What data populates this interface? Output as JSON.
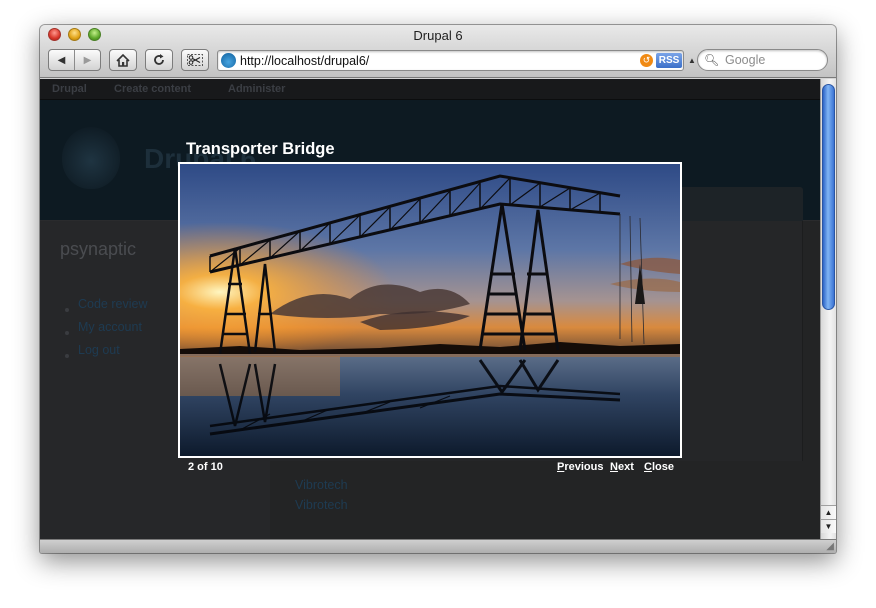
{
  "window": {
    "title": "Drupal 6"
  },
  "toolbar": {
    "back_label": "◀",
    "forward_label": "▶",
    "home_icon": "home-icon",
    "reload_icon": "reload-icon",
    "snippet_icon": "scissors-icon"
  },
  "address": {
    "url": "http://localhost/drupal6/",
    "rss_label": "RSS",
    "snapback_label": "↺"
  },
  "search": {
    "placeholder": "Google"
  },
  "page": {
    "menu": [
      "Drupal",
      "Create content",
      "Administer"
    ],
    "site_name": "Drupal 6",
    "user_name": "psynaptic",
    "user_links": [
      "Code review",
      "My account",
      "Log out"
    ],
    "main_links": [
      "Vibrotech",
      "Vibrotech"
    ]
  },
  "lightbox": {
    "title": "Transporter Bridge",
    "counter": "2 of 10",
    "previous_first": "P",
    "previous_rest": "revious",
    "next_first": "N",
    "next_rest": "ext",
    "close_first": "C",
    "close_rest": "lose"
  },
  "colors": {
    "page_dark": "#2a2b2d",
    "link_dark": "#1e3b52",
    "scroll_thumb": "#3b73d3"
  }
}
